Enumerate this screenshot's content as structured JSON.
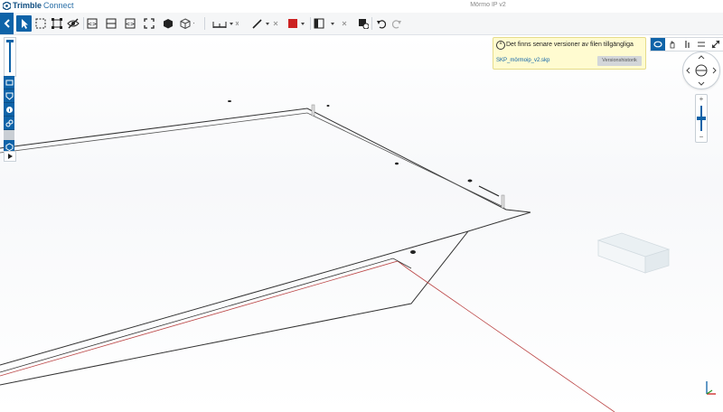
{
  "app": {
    "brand_strong": "Trimble",
    "brand_light": "Connect",
    "document_title": "Mörmo IP v2"
  },
  "toolbar": {
    "tools": [
      "select-pointer",
      "box-select",
      "select-vertices",
      "hide-objects",
      "section-box",
      "section-plane",
      "fit-view",
      "full-screen",
      "object-cube",
      "measure",
      "draw-line",
      "color-swatch",
      "visibility",
      "model-settings",
      "undo",
      "redo"
    ],
    "accent_color": "#0e63a8",
    "swatch_color": "#cc2222"
  },
  "notification": {
    "message": "Det finns senare versioner av filen tillgängliga",
    "file_name": "SKP_mörmoip_v2.skp",
    "button_label": "Versionshistorik"
  },
  "navigation": {
    "modes": [
      "orbit",
      "pan",
      "walk",
      "fly",
      "fullscreen"
    ],
    "zoom_level": 0.5
  }
}
